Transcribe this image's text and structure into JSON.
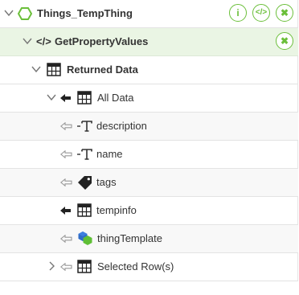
{
  "thing": {
    "name": "Things_TempThing"
  },
  "service": {
    "name": "GetPropertyValues",
    "icon_text": "</>"
  },
  "tree": {
    "returned_data": "Returned Data",
    "all_data": "All Data",
    "fields": [
      "description",
      "name",
      "tags",
      "tempinfo",
      "thingTemplate"
    ],
    "selected_rows": "Selected Row(s)"
  },
  "buttons": {
    "info_text": "i",
    "code_text": "</>",
    "close_glyph": "✖"
  },
  "icons": {
    "thing": "hexagon-icon",
    "service": "code-icon",
    "table": "table-icon",
    "string": "text-type-icon",
    "tags": "tag-icon",
    "thingTemplate": "thing-template-icon",
    "input_arrow": "input-arrow-icon",
    "bound_arrow": "bound-arrow-icon"
  },
  "colors": {
    "accent": "#6bbf3a",
    "service_bg": "#eaf5e4",
    "row_alt": "#f8f8f8"
  }
}
